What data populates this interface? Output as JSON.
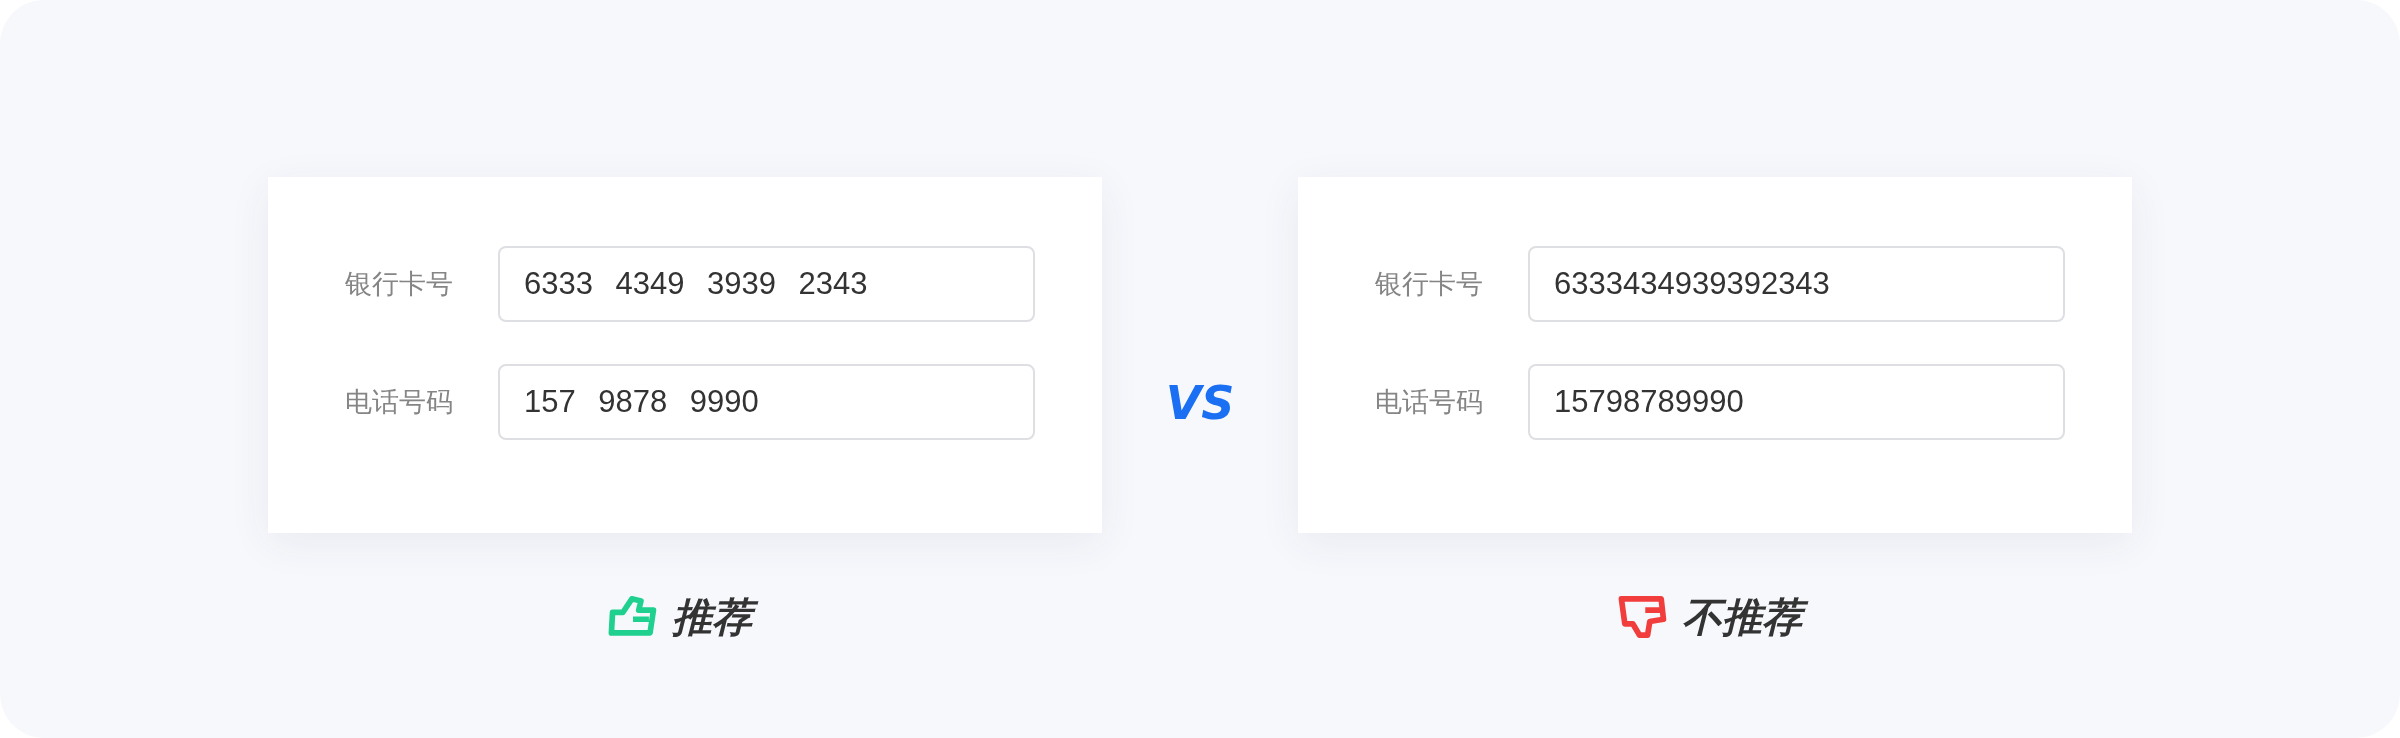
{
  "panels": [
    {
      "fields": [
        {
          "label": "银行卡号",
          "value": "6333 4349 3939 2343"
        },
        {
          "label": "电话号码",
          "value": "157 9878 9990"
        }
      ],
      "verdict": {
        "kind": "recommended",
        "text": "推荐"
      }
    },
    {
      "fields": [
        {
          "label": "银行卡号",
          "value": "6333434939392343"
        },
        {
          "label": "电话号码",
          "value": "15798789990"
        }
      ],
      "verdict": {
        "kind": "not_recommended",
        "text": "不推荐"
      }
    }
  ],
  "separator": "VS"
}
